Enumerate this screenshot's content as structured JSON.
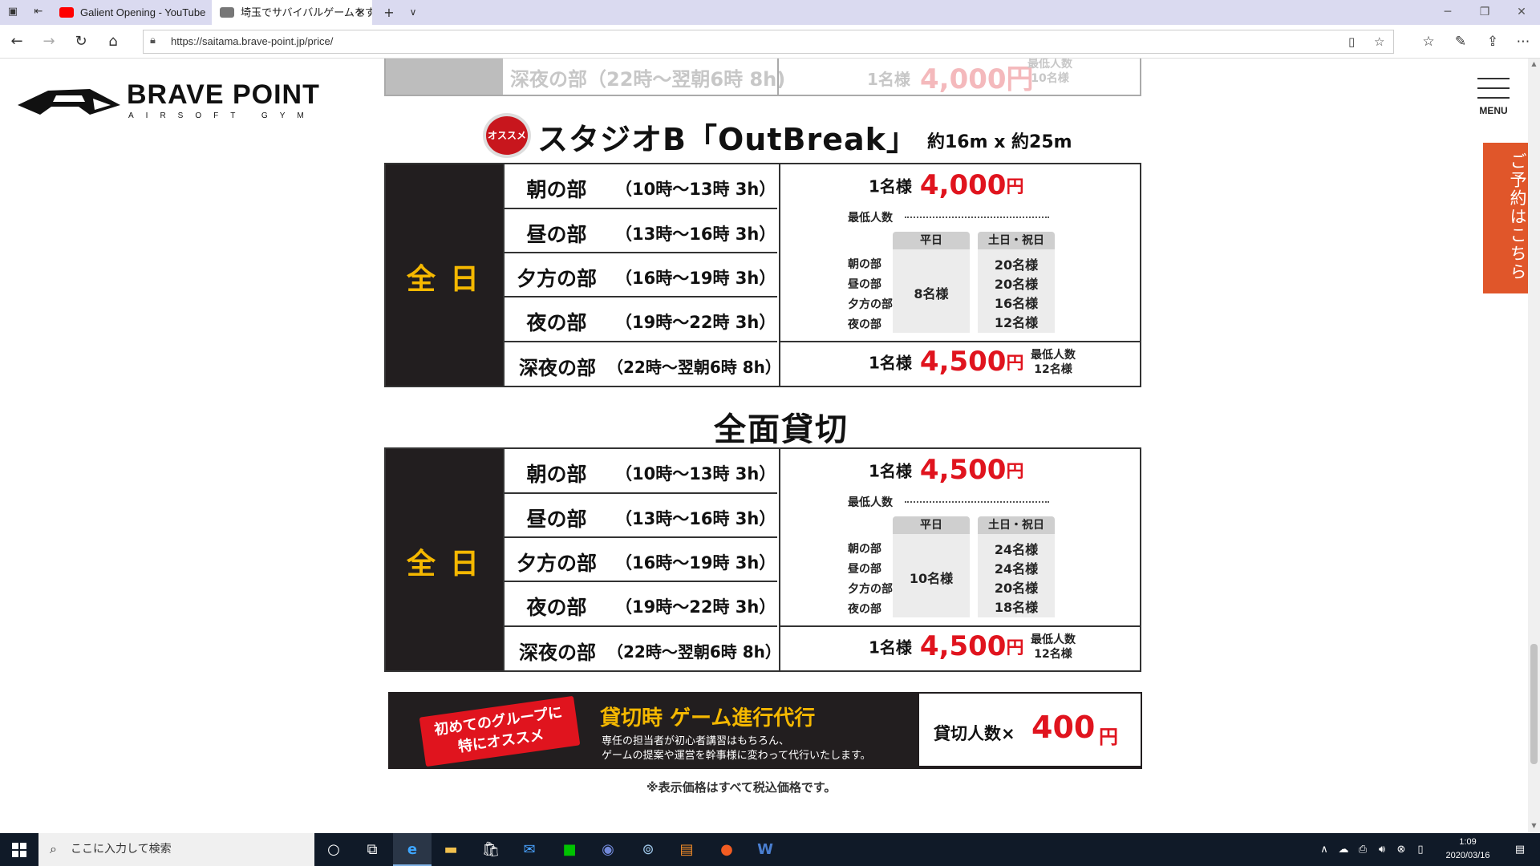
{
  "browser": {
    "tabs": [
      {
        "label": "Galient Opening - YouTube",
        "favicon": "youtube-icon",
        "color": "#ff0000"
      },
      {
        "label": "埼玉でサバイバルゲームをす",
        "favicon": "bravepoint-icon",
        "color": "#666666"
      }
    ],
    "url": "https://saitama.brave-point.jp/price/"
  },
  "site": {
    "brand": "BRAVE POINT",
    "tagline": "AIRSOFT GYM",
    "menu_label": "MENU",
    "reserve_label": "ご予約はこちら"
  },
  "prev_table_row": {
    "name": "深夜の部（22時〜翌朝6時 8h)",
    "per": "1名様",
    "amount": "4,000円",
    "min": "最低人数",
    "min_value": "10名様"
  },
  "studio_b": {
    "badge": "オススメ",
    "title": "スタジオB「OutBreak」",
    "size": "約16m x 約25m"
  },
  "table1": {
    "allday": "全日",
    "slots": [
      {
        "name": "朝の部",
        "time": "（10時〜13時 3h）"
      },
      {
        "name": "昼の部",
        "time": "（13時〜16時 3h）"
      },
      {
        "name": "夕方の部",
        "time": "（16時〜19時 3h）"
      },
      {
        "name": "夜の部",
        "time": "（19時〜22時 3h）"
      }
    ],
    "night": {
      "name": "深夜の部",
      "time": "（22時〜翌朝6時 8h）"
    },
    "per": "1名様",
    "price": "4,000",
    "yen": "円",
    "min_label": "最低人数",
    "weekday_header": "平日",
    "weekend_header": "土日・祝日",
    "slot_labels": [
      "朝の部",
      "昼の部",
      "夕方の部",
      "夜の部"
    ],
    "weekday_value": "8名様",
    "weekend_values": [
      "20名様",
      "20名様",
      "16名様",
      "12名様"
    ],
    "night_per": "1名様",
    "night_price": "4,500",
    "night_min_label": "最低人数",
    "night_min_value": "12名様"
  },
  "full_rental_heading": "全面貸切",
  "table2": {
    "allday": "全日",
    "slots": [
      {
        "name": "朝の部",
        "time": "（10時〜13時 3h）"
      },
      {
        "name": "昼の部",
        "time": "（13時〜16時 3h）"
      },
      {
        "name": "夕方の部",
        "time": "（16時〜19時 3h）"
      },
      {
        "name": "夜の部",
        "time": "（19時〜22時 3h）"
      }
    ],
    "night": {
      "name": "深夜の部",
      "time": "（22時〜翌朝6時 8h）"
    },
    "per": "1名様",
    "price": "4,500",
    "yen": "円",
    "min_label": "最低人数",
    "weekday_header": "平日",
    "weekend_header": "土日・祝日",
    "slot_labels": [
      "朝の部",
      "昼の部",
      "夕方の部",
      "夜の部"
    ],
    "weekday_value": "10名様",
    "weekend_values": [
      "24名様",
      "24名様",
      "20名様",
      "18名様"
    ],
    "night_per": "1名様",
    "night_price": "4,500",
    "night_min_label": "最低人数",
    "night_min_value": "12名様"
  },
  "banner": {
    "tag_line1": "初めてのグループに",
    "tag_line2": "特にオススメ",
    "title": "貸切時 ゲーム進行代行",
    "desc1": "専任の担当者が初心者講習はもちろん、",
    "desc2": "ゲームの提案や運営を幹事様に変わって代行いたします。",
    "price_label": "貸切人数×",
    "price": "400",
    "yen": "円"
  },
  "note": "※表示価格はすべて税込価格です。",
  "taskbar": {
    "search_placeholder": "ここに入力して検索",
    "time": "1:09",
    "date": "2020/03/16"
  }
}
